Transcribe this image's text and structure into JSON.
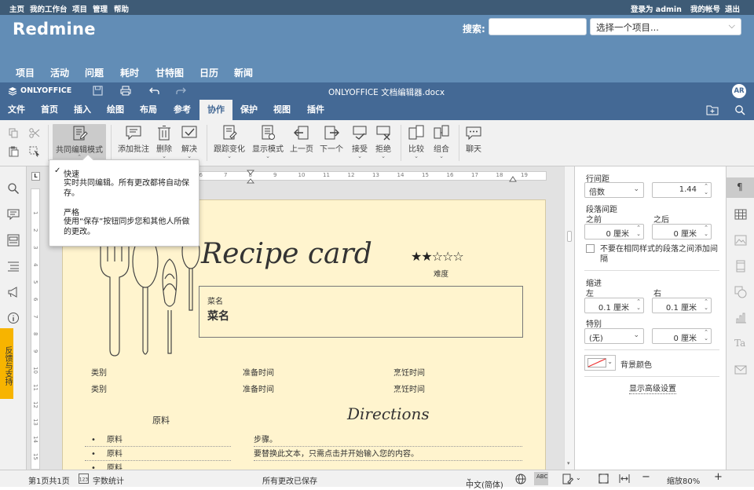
{
  "redmine": {
    "top_left": [
      "主页",
      "我的工作台",
      "项目",
      "管理",
      "帮助"
    ],
    "logged_in_as": "登录为 admin",
    "my_account": "我的帐号",
    "logout": "退出",
    "logo": "Redmine",
    "search_label": "搜索:",
    "search_placeholder": "",
    "project_select": "选择一个项目...",
    "menu": [
      "项目",
      "活动",
      "问题",
      "耗时",
      "甘特图",
      "日历",
      "新闻"
    ]
  },
  "oo": {
    "brand": "ONLYOFFICE",
    "doc_title": "ONLYOFFICE 文档编辑器.docx",
    "user_initials": "AR",
    "tabs": [
      "文件",
      "首页",
      "插入",
      "绘图",
      "布局",
      "参考",
      "协作",
      "保护",
      "视图",
      "插件"
    ],
    "active_tab": "协作",
    "toolbar": {
      "co_edit": "共同编辑模式",
      "add_comment": "添加批注",
      "delete": "删除",
      "resolve": "解决",
      "track": "跟踪变化",
      "display": "显示模式",
      "prev": "上一页",
      "next": "下一个",
      "accept": "接受",
      "reject": "拒绝",
      "compare": "比较",
      "combine": "组合",
      "chat": "聊天"
    },
    "popup": {
      "fast_title": "快速",
      "fast_desc": "实时共同编辑。所有更改都将自动保存。",
      "strict_title": "严格",
      "strict_desc": "使用“保存”按钮同步您和其他人所做的更改。"
    },
    "feedback": "反馈与支持",
    "ruler_numbers": [
      "1",
      "2",
      "3",
      "4",
      "5",
      "6",
      "7",
      "8",
      "9",
      "10",
      "11",
      "12",
      "13",
      "14",
      "15",
      "16",
      "17",
      "18",
      "19"
    ],
    "vruler_numbers": [
      "1",
      "2",
      "3",
      "4",
      "5",
      "6",
      "7",
      "8",
      "9",
      "10",
      "11",
      "12",
      "13",
      "14",
      "15",
      "16"
    ]
  },
  "doc": {
    "recipe_title": "Recipe card",
    "stars": "★★☆☆☆",
    "difficulty": "难度",
    "dish_label": "菜名",
    "dish_name": "菜名",
    "rows": [
      {
        "c1": "类别",
        "c2": "准备时间",
        "c3": "烹饪时间"
      },
      {
        "c1": "类别",
        "c2": "准备时间",
        "c3": "烹饪时间"
      }
    ],
    "ingredients_title": "原料",
    "directions_title": "Directions",
    "ingredients": [
      "原料",
      "原料",
      "原料"
    ],
    "steps": [
      "步骤。",
      "要替换此文本，只需点击并开始输入您的内容。"
    ]
  },
  "panel": {
    "line_spacing": "行间距",
    "line_spacing_type": "倍数",
    "line_spacing_value": "1.44",
    "para_spacing": "段落间距",
    "before": "之前",
    "after": "之后",
    "before_value": "0 厘米",
    "after_value": "0 厘米",
    "no_space_same_style": "不要在相同样式的段落之间添加间隔",
    "indent": "缩进",
    "left": "左",
    "right": "右",
    "left_value": "0.1 厘米",
    "right_value": "0.1 厘米",
    "special": "特别",
    "special_type": "(无)",
    "special_value": "0 厘米",
    "bg_color": "背景颜色",
    "advanced": "显示高级设置"
  },
  "status": {
    "page": "第1页共1页",
    "word_count": "字数统计",
    "saved": "所有更改已保存",
    "language": "中文(简体)",
    "zoom": "缩放80%"
  },
  "colors": {
    "redmine_top": "#3e5b76",
    "redmine_header": "#628db6",
    "oo_blue": "#446995",
    "page_bg": "#fff4ce",
    "feedback": "#f7b400"
  }
}
